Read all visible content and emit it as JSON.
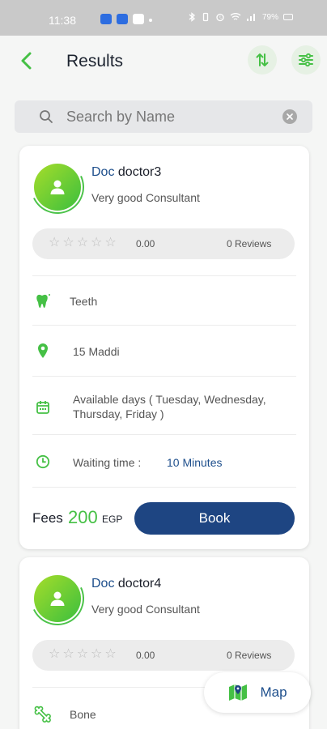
{
  "status_bar": {
    "time": "11:38",
    "right_text": "79%"
  },
  "header": {
    "title": "Results",
    "back_icon": "chevron-left-icon",
    "sort_icon": "sort-arrows-icon",
    "filter_icon": "sliders-icon"
  },
  "search": {
    "placeholder": "Search by Name",
    "value": ""
  },
  "colors": {
    "accent_green": "#45c045",
    "primary_blue": "#1e4582",
    "doc_blue": "#1e4f8c"
  },
  "doctors": [
    {
      "prefix": "Doc",
      "name": "doctor3",
      "subtitle": "Very good Consultant",
      "rating": "0.00",
      "reviews": "0 Reviews",
      "stars": 0,
      "specialty": "Teeth",
      "specialty_icon": "tooth-icon",
      "address": "15 Maddi",
      "days": "Available days ( Tuesday, Wednesday, Thursday, Friday )",
      "wait_label": "Waiting time :",
      "wait_value": "10 Minutes",
      "fees_label": "Fees",
      "fees_amount": "200",
      "currency": "EGP",
      "book_label": "Book"
    },
    {
      "prefix": "Doc",
      "name": "doctor4",
      "subtitle": "Very good Consultant",
      "rating": "0.00",
      "reviews": "0 Reviews",
      "stars": 0,
      "specialty": "Bone",
      "specialty_icon": "bone-icon"
    }
  ],
  "map_button": {
    "label": "Map",
    "icon": "map-icon"
  }
}
